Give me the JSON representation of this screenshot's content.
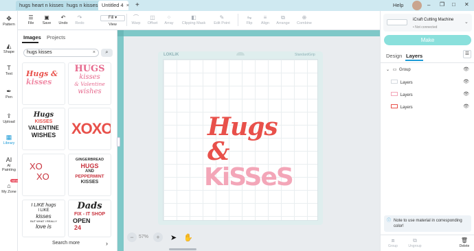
{
  "tabs": [
    {
      "label": "hugs heart n kisses"
    },
    {
      "label": "hugs n kisses"
    },
    {
      "label": "Untitled 4"
    }
  ],
  "window": {
    "help": "Help",
    "new_tab": "+",
    "tab_close": "×",
    "minimize": "–",
    "maximize": "□",
    "restore": "❐",
    "close": "✕"
  },
  "toolbar": {
    "file": "File",
    "save": "Save",
    "undo": "Undo",
    "redo": "Redo",
    "fill": "Fill",
    "view": "View",
    "warp": "Warp",
    "offset": "Offset",
    "array": "Array",
    "clipping_mask": "Clipping Mask",
    "edit_point": "Edit Point",
    "flip": "Flip",
    "align": "Align",
    "arrange": "Arrange",
    "combine": "Combine"
  },
  "rail": {
    "pattern": "Pattern",
    "shape": "Shape",
    "text": "Text",
    "pen": "Pen",
    "upload": "Upload",
    "library": "Library",
    "ai_painting": "AI Painting",
    "my_zone": "My Zone",
    "new_badge": "NEW"
  },
  "library": {
    "tab_images": "Images",
    "tab_projects": "Projects",
    "search_value": "hugs kisses",
    "search_clear": "×",
    "search_more": "Search more",
    "chevron": "›",
    "cards": [
      {
        "lines": [
          "Hugs &",
          "kisses"
        ]
      },
      {
        "lines": [
          "HUGS",
          "kisses",
          "& Valentine",
          "wishes"
        ]
      },
      {
        "lines": [
          "Hugs",
          "KISSES",
          "VALENTINE",
          "WISHES"
        ]
      },
      {
        "lines": [
          "XOXO"
        ]
      },
      {
        "lines": [
          "XO",
          "XO"
        ]
      },
      {
        "lines": [
          "GINGERBREAD",
          "HUGS",
          "AND",
          "PEPPERMINT",
          "KISSES"
        ]
      },
      {
        "lines": [
          "I LIKE hugs",
          "I LIKE",
          "kisses",
          "BUT WHAT I REALLY",
          "love is"
        ]
      },
      {
        "lines": [
          "Dads",
          "FIX - IT SHOP",
          "OPEN",
          "24"
        ]
      }
    ]
  },
  "canvas": {
    "mat_brand": "LOKLiK",
    "mat_type": "StandardGrip",
    "design_line1": "Hugs &",
    "design_line2": "KiSSeS",
    "zoom": "57%",
    "zoom_minus": "−",
    "zoom_plus": "+"
  },
  "right": {
    "machine_name": "iCraft Cutting Machine",
    "machine_status": "Not connected",
    "make": "Make",
    "tab_design": "Design",
    "tab_layers": "Layers",
    "group": "Group",
    "layers": [
      "Layers",
      "Layers",
      "Layers"
    ],
    "note": "Note to use material in corresponding color!",
    "bottom_group": "Group",
    "bottom_ungroup": "Ungroup",
    "bottom_delete": "Delete"
  },
  "colors": {
    "accent": "#1d9bd7",
    "make_btn": "#8ae0dc",
    "hugs_red": "#e8504a",
    "kisses_pink": "#f3a6b8",
    "ruler": "#7fc8c8"
  }
}
